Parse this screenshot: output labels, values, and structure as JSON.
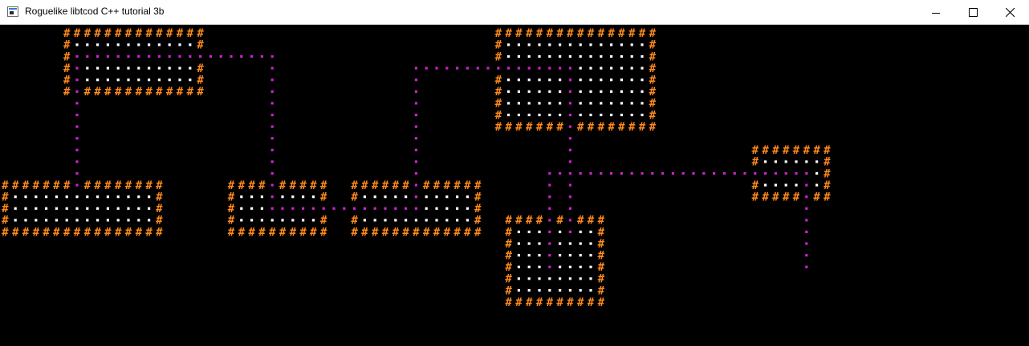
{
  "window": {
    "title": "Roguelike libtcod C++ tutorial 3b",
    "controls": [
      {
        "icon": "minimize-icon"
      },
      {
        "icon": "maximize-icon"
      },
      {
        "icon": "close-icon"
      }
    ]
  },
  "colors": {
    "wall": "#ff8a1c",
    "floor": "#ffffff",
    "corridor": "#cc22cc",
    "background": "#000000",
    "titlebar": "#ffffff"
  },
  "glyphs": {
    "wall": "#",
    "floor": ".",
    "corridor": "."
  },
  "map": {
    "rooms": [
      {
        "name": "room-1",
        "col": 6,
        "row": 0,
        "cols": 14,
        "rows": 6
      },
      {
        "name": "room-2",
        "col": 0,
        "row": 13,
        "cols": 16,
        "rows": 5
      },
      {
        "name": "room-3",
        "col": 22,
        "row": 13,
        "cols": 10,
        "rows": 5
      },
      {
        "name": "room-4",
        "col": 34,
        "row": 13,
        "cols": 13,
        "rows": 5
      },
      {
        "name": "room-5",
        "col": 48,
        "row": 0,
        "cols": 16,
        "rows": 9
      },
      {
        "name": "room-6",
        "col": 49,
        "row": 16,
        "cols": 10,
        "rows": 8
      },
      {
        "name": "room-7",
        "col": 73,
        "row": 10,
        "cols": 8,
        "rows": 5
      }
    ],
    "corridors": [
      {
        "row": 2,
        "from": 7,
        "to": 26
      },
      {
        "col": 7,
        "from": 2,
        "to": 13
      },
      {
        "col": 26,
        "from": 2,
        "to": 14
      },
      {
        "row": 15,
        "from": 26,
        "to": 40
      },
      {
        "row": 3,
        "from": 40,
        "to": 55
      },
      {
        "col": 40,
        "from": 3,
        "to": 15
      },
      {
        "col": 55,
        "from": 3,
        "to": 17
      },
      {
        "row": 12,
        "from": 53,
        "to": 78
      },
      {
        "col": 53,
        "from": 12,
        "to": 20
      },
      {
        "col": 78,
        "from": 12,
        "to": 20
      }
    ]
  }
}
